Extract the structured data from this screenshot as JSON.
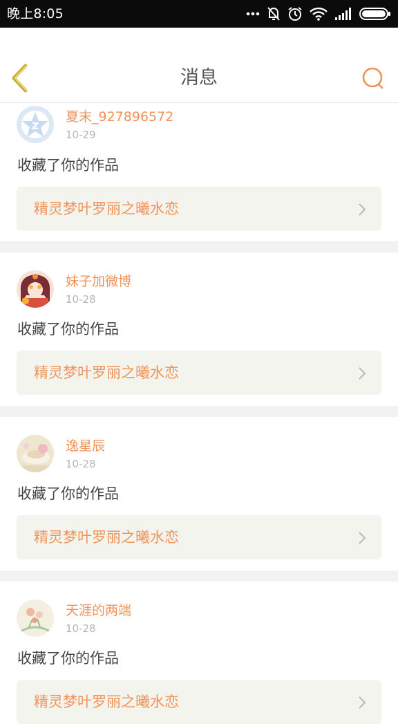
{
  "status_bar": {
    "time": "晚上8:05"
  },
  "header": {
    "title": "消息"
  },
  "messages": [
    {
      "username": "夏末_927896572",
      "date": "10-29",
      "action": "收藏了你的作品",
      "work_title": "精灵梦叶罗丽之曦水恋"
    },
    {
      "username": "妹子加微博",
      "date": "10-28",
      "action": "收藏了你的作品",
      "work_title": "精灵梦叶罗丽之曦水恋"
    },
    {
      "username": "逸星辰",
      "date": "10-28",
      "action": "收藏了你的作品",
      "work_title": "精灵梦叶罗丽之曦水恋"
    },
    {
      "username": "天涯的两端",
      "date": "10-28",
      "action": "收藏了你的作品",
      "work_title": "精灵梦叶罗丽之曦水恋"
    }
  ],
  "colors": {
    "accent": "#f0935a",
    "link_background": "#f4f4ee",
    "separator": "#f2f2f2",
    "back_arrow": "#c7b02e"
  },
  "icons": {
    "back": "chevron-left-icon",
    "search": "search-icon",
    "row_arrow": "chevron-right-icon"
  }
}
